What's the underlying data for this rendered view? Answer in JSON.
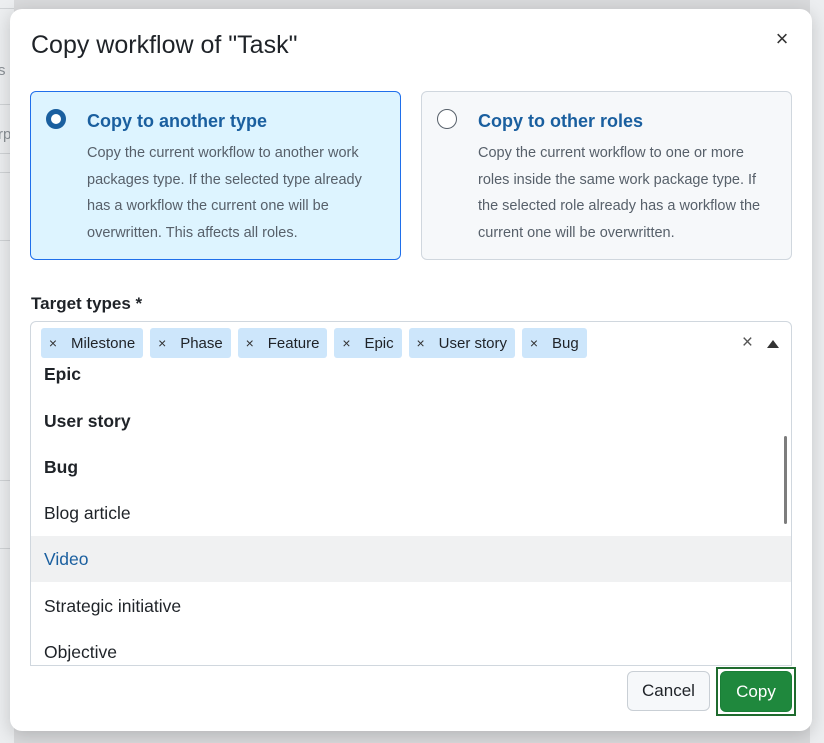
{
  "backdrop": {
    "fragments": [
      "s",
      "rp"
    ]
  },
  "dialog": {
    "title": "Copy workflow of \"Task\"",
    "close_label": "×",
    "options": [
      {
        "title": "Copy to another type",
        "description": "Copy the current workflow to another work packages type. If the selected type already has a workflow the current one will be overwritten. This affects all roles.",
        "selected": true
      },
      {
        "title": "Copy to other roles",
        "description": "Copy the current workflow to one or more roles inside the same work package type. If the selected role already has a workflow the current one will be overwritten.",
        "selected": false
      }
    ],
    "field_label": "Target types *",
    "chips": [
      "Milestone",
      "Phase",
      "Feature",
      "Epic",
      "User story",
      "Bug"
    ],
    "chip_remove": "×",
    "clear_all": "×",
    "dropdown_items": [
      {
        "label": "Epic",
        "selected": true
      },
      {
        "label": "User story",
        "selected": true
      },
      {
        "label": "Bug",
        "selected": true
      },
      {
        "label": "Blog article",
        "selected": false
      },
      {
        "label": "Video",
        "selected": false,
        "highlighted": true
      },
      {
        "label": "Strategic initiative",
        "selected": false
      },
      {
        "label": "Objective",
        "selected": false
      }
    ],
    "buttons": {
      "cancel": "Cancel",
      "copy": "Copy"
    }
  },
  "colors": {
    "accent": "#1a5f9f",
    "primary_button": "#1f883d",
    "selected_card_bg": "#ddf4ff",
    "chip_bg": "#cde6fb"
  }
}
